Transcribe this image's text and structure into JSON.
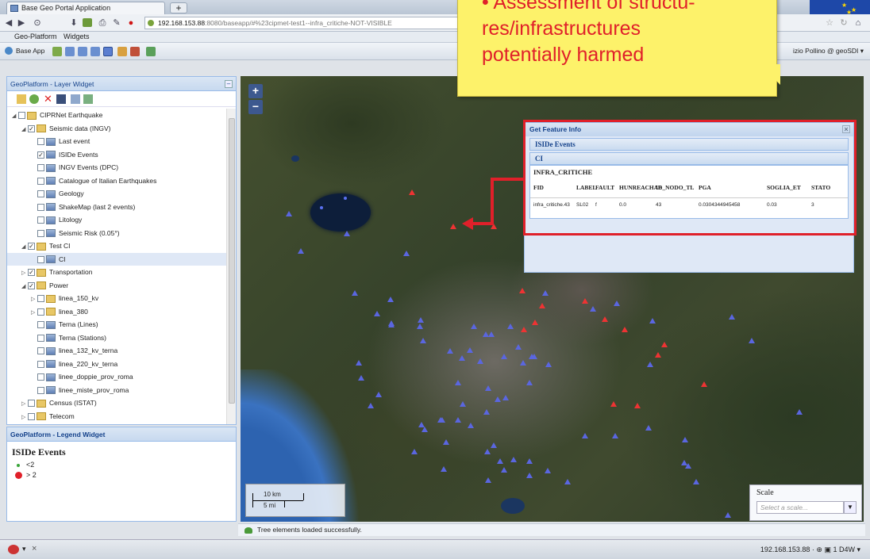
{
  "browser": {
    "tab_title": "Base Geo Portal Application",
    "new_tab": "+",
    "url_host": "192.168.153.88",
    "url_path": ":8080/baseapp/#%23cipmet-test1--infra_critiche-NOT-VISIBLE"
  },
  "menubar": {
    "items": [
      "Geo-Platform",
      "Widgets"
    ]
  },
  "toolbar": {
    "base_app_label": "Base App",
    "user_label": "izio Pollino @ geoSDI ▾"
  },
  "layer_widget": {
    "title": "GeoPlatform - Layer Widget",
    "tree": [
      {
        "label": "CIPRNet Earthquake",
        "level": 0,
        "expanded": true,
        "checked": false,
        "kind": "root"
      },
      {
        "label": "Seismic data (INGV)",
        "level": 1,
        "expanded": true,
        "checked": true,
        "kind": "folder"
      },
      {
        "label": "Last event",
        "level": 2,
        "checked": false,
        "kind": "layer"
      },
      {
        "label": "ISIDe Events",
        "level": 2,
        "checked": true,
        "kind": "layer"
      },
      {
        "label": "INGV Events (DPC)",
        "level": 2,
        "checked": false,
        "kind": "layer"
      },
      {
        "label": "Catalogue of Italian Earthquakes",
        "level": 2,
        "checked": false,
        "kind": "layer"
      },
      {
        "label": "Geology",
        "level": 2,
        "checked": false,
        "kind": "layer"
      },
      {
        "label": "ShakeMap (last 2 events)",
        "level": 2,
        "checked": false,
        "kind": "layer"
      },
      {
        "label": "Litology",
        "level": 2,
        "checked": false,
        "kind": "layer"
      },
      {
        "label": "Seismic Risk (0.05°)",
        "level": 2,
        "checked": false,
        "kind": "layer"
      },
      {
        "label": "Test CI",
        "level": 1,
        "expanded": true,
        "checked": true,
        "kind": "folder"
      },
      {
        "label": "CI",
        "level": 2,
        "checked": false,
        "kind": "layer",
        "selected": true
      },
      {
        "label": "Transportation",
        "level": 1,
        "expanded": false,
        "checked": true,
        "kind": "folder"
      },
      {
        "label": "Power",
        "level": 1,
        "expanded": true,
        "checked": true,
        "kind": "folder"
      },
      {
        "label": "linea_150_kv",
        "level": 2,
        "expanded": false,
        "checked": false,
        "kind": "folder"
      },
      {
        "label": "linea_380",
        "level": 2,
        "expanded": false,
        "checked": false,
        "kind": "folder"
      },
      {
        "label": "Terna (Lines)",
        "level": 2,
        "checked": false,
        "kind": "layer"
      },
      {
        "label": "Terna (Stations)",
        "level": 2,
        "checked": false,
        "kind": "layer"
      },
      {
        "label": "linea_132_kv_terna",
        "level": 2,
        "checked": false,
        "kind": "layer"
      },
      {
        "label": "linea_220_kv_terna",
        "level": 2,
        "checked": false,
        "kind": "layer"
      },
      {
        "label": "linee_doppie_prov_roma",
        "level": 2,
        "checked": false,
        "kind": "layer"
      },
      {
        "label": "linee_miste_prov_roma",
        "level": 2,
        "checked": false,
        "kind": "layer"
      },
      {
        "label": "Census (ISTAT)",
        "level": 1,
        "expanded": false,
        "checked": false,
        "kind": "folder"
      },
      {
        "label": "Telecom",
        "level": 1,
        "expanded": false,
        "checked": false,
        "kind": "folder"
      }
    ]
  },
  "legend_widget": {
    "title": "GeoPlatform - Legend Widget",
    "layer": "ISIDe Events",
    "entries": [
      {
        "label": "<2",
        "color": "#3aa53a"
      },
      {
        "label": "> 2",
        "color": "#e0202a"
      }
    ]
  },
  "map": {
    "zoom_in": "+",
    "zoom_out": "−",
    "scale_km": "10 km",
    "scale_mi": "5 mi",
    "scale_label": "Scale",
    "scale_placeholder": "Select a scale...",
    "status": "Tree elements loaded successfully."
  },
  "feature_info": {
    "title": "Get Feature Info",
    "group": "ISIDe Events",
    "layer": "CI",
    "table_caption": "INFRA_CRITICHE",
    "columns": [
      "FID",
      "LABEL",
      "FAULT",
      "HUNREACHAB",
      "ID_NODO_TL",
      "PGA",
      "SOGLIA_ET",
      "STATO"
    ],
    "row": [
      "infra_critiche.43",
      "SL02",
      "f",
      "0.0",
      "43",
      "0.0304344945458",
      "0.03",
      "3"
    ]
  },
  "callout": {
    "lines": [
      "• Assessment of structu-",
      "res/infrastructures",
      "potentially harmed"
    ]
  },
  "bottom": {
    "status_right": "192.168.153.88 ·  ⊕  ▣ 1  D4W  ▾"
  },
  "colors": {
    "alert_red": "#e0202a",
    "callout_yellow": "#fdf26a",
    "ext_blue": "#15428b"
  }
}
